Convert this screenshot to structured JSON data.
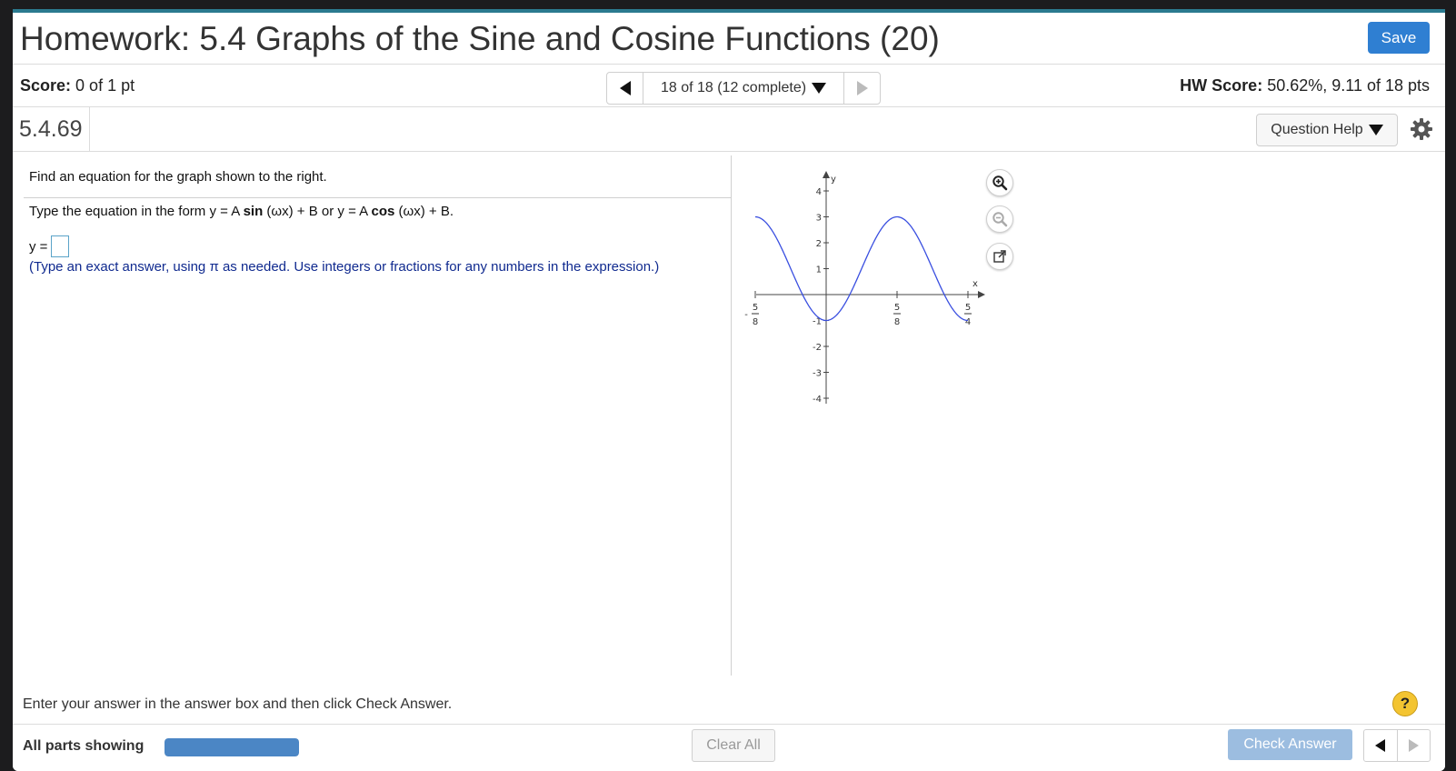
{
  "header": {
    "title": "Homework: 5.4 Graphs of the Sine and Cosine Functions (20)",
    "save_label": "Save"
  },
  "score_row": {
    "score_label": "Score:",
    "score_value": "0 of 1 pt",
    "nav_text": "18 of 18 (12 complete)",
    "hw_label": "HW Score:",
    "hw_value": "50.62%, 9.11 of 18 pts"
  },
  "question_row": {
    "id": "5.4.69",
    "help_label": "Question Help"
  },
  "question": {
    "prompt": "Find an equation for the graph shown to the right.",
    "form_prefix": "Type the equation in the form y = A ",
    "form_sin": "sin",
    "form_mid": " (ωx) + B or y = A ",
    "form_cos": "cos",
    "form_suffix": " (ωx) + B.",
    "answer_label": "y =",
    "answer_value": "",
    "hint": "(Type an exact answer, using π as needed. Use integers or fractions for any numbers in the expression.)"
  },
  "graph": {
    "x_axis_label": "x",
    "y_axis_label": "y",
    "y_ticks": [
      "4",
      "3",
      "2",
      "1",
      "-1",
      "-2",
      "-3",
      "-4"
    ],
    "x_ticks": [
      {
        "sign": "-",
        "num": "5",
        "den": "8"
      },
      {
        "sign": "",
        "num": "5",
        "den": "8"
      },
      {
        "sign": "",
        "num": "5",
        "den": "4"
      }
    ],
    "curve_color": "#3a4fe0"
  },
  "chart_data": {
    "type": "line",
    "title": "",
    "xlabel": "x",
    "ylabel": "y",
    "ylim": [
      -4,
      4
    ],
    "x_tick_labels": [
      "-5/8",
      "5/8",
      "5/4"
    ],
    "y_tick_labels": [
      "-4",
      "-3",
      "-2",
      "-1",
      "1",
      "2",
      "3",
      "4"
    ],
    "series": [
      {
        "x": [
          "-5/8",
          "0",
          "5/8",
          "5/4"
        ],
        "values": [
          3,
          -1,
          3,
          -1
        ]
      }
    ]
  },
  "footer": {
    "instruction": "Enter your answer in the answer box and then click Check Answer.",
    "help_glyph": "?",
    "parts_label": "All parts showing",
    "progress_fraction": 1.0,
    "clear_label": "Clear All",
    "check_label": "Check Answer"
  },
  "colors": {
    "accent": "#2f7fd2",
    "top_border": "#2b7a8f",
    "hint_text": "#102a8f",
    "progress_fill": "#4b86c5"
  },
  "icons": {
    "zoom_in": "zoom-in-icon",
    "zoom_out": "zoom-out-icon",
    "popout": "popout-icon",
    "settings": "gear-icon"
  }
}
